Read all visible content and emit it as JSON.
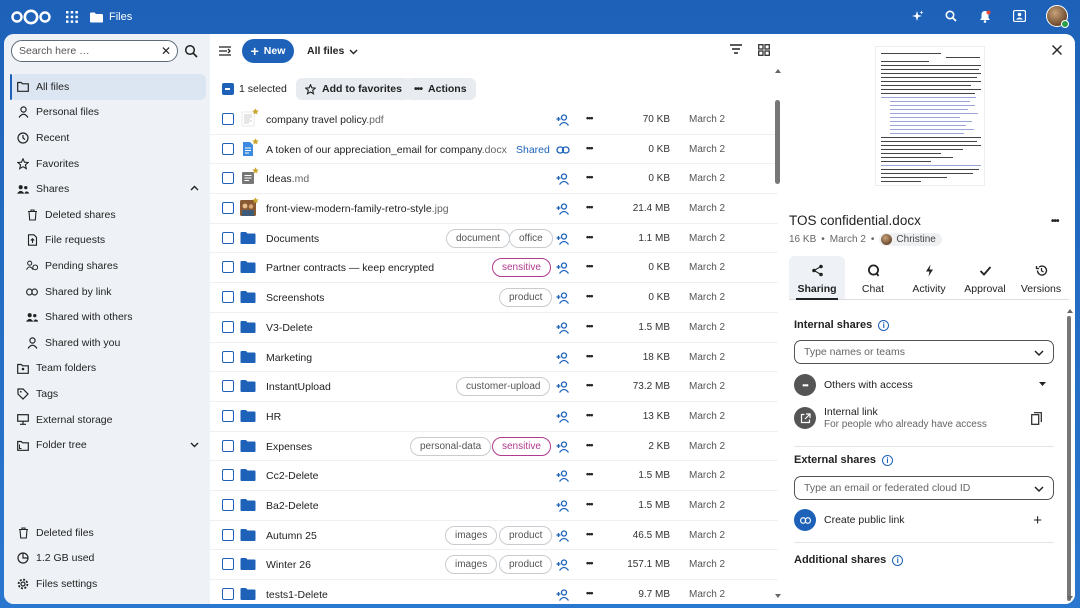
{
  "header": {
    "app_name": "Files"
  },
  "search": {
    "placeholder": "Search here …"
  },
  "nav": {
    "items": [
      {
        "label": "All files",
        "icon": "folder-icon"
      },
      {
        "label": "Personal files",
        "icon": "person-icon"
      },
      {
        "label": "Recent",
        "icon": "clock-icon"
      },
      {
        "label": "Favorites",
        "icon": "star-icon"
      },
      {
        "label": "Shares",
        "icon": "share-icon"
      },
      {
        "label": "Deleted shares",
        "icon": "trash-icon"
      },
      {
        "label": "File requests",
        "icon": "file-upload-icon"
      },
      {
        "label": "Pending shares",
        "icon": "pending-icon"
      },
      {
        "label": "Shared by link",
        "icon": "link-icon"
      },
      {
        "label": "Shared with others",
        "icon": "group-icon"
      },
      {
        "label": "Shared with you",
        "icon": "person-icon"
      },
      {
        "label": "Team folders",
        "icon": "team-folder-icon"
      },
      {
        "label": "Tags",
        "icon": "tag-icon"
      },
      {
        "label": "External storage",
        "icon": "storage-icon"
      },
      {
        "label": "Folder tree",
        "icon": "folder-tree-icon"
      }
    ],
    "bottom": [
      {
        "label": "Deleted files",
        "icon": "trash-icon"
      },
      {
        "label": "1.2 GB used",
        "icon": "pie-icon"
      },
      {
        "label": "Files settings",
        "icon": "gear-icon"
      }
    ]
  },
  "toolbar": {
    "new_label": "New",
    "breadcrumb": "All files"
  },
  "selection": {
    "count": "1 selected",
    "favorite_label": "Add to favorites",
    "actions_label": "Actions"
  },
  "files": [
    {
      "name": "company travel policy",
      "ext": ".pdf",
      "size": "70 KB",
      "date": "March 2",
      "type": "pdf",
      "fav": true,
      "tags": []
    },
    {
      "name": "A token of our appreciation_email for company",
      "ext": ".docx",
      "size": "0 KB",
      "date": "March 2",
      "type": "doc",
      "fav": true,
      "shared": "Shared",
      "tags": []
    },
    {
      "name": "Ideas",
      "ext": ".md",
      "size": "0 KB",
      "date": "March 2",
      "type": "md",
      "fav": true,
      "tags": []
    },
    {
      "name": "front-view-modern-family-retro-style",
      "ext": ".jpg",
      "size": "21.4 MB",
      "date": "March 2",
      "type": "img",
      "fav": true,
      "tags": []
    },
    {
      "name": "Documents",
      "ext": "",
      "size": "1.1 MB",
      "date": "March 2",
      "type": "folder",
      "tags": [
        "document",
        "office"
      ]
    },
    {
      "name": "Partner contracts — keep encrypted",
      "ext": "",
      "size": "0 KB",
      "date": "March 2",
      "type": "folder",
      "tags": [
        "sensitive"
      ]
    },
    {
      "name": "Screenshots",
      "ext": "",
      "size": "0 KB",
      "date": "March 2",
      "type": "folder",
      "tags": [
        "product"
      ]
    },
    {
      "name": "V3-Delete",
      "ext": "",
      "size": "1.5 MB",
      "date": "March 2",
      "type": "folder",
      "tags": []
    },
    {
      "name": "Marketing",
      "ext": "",
      "size": "18 KB",
      "date": "March 2",
      "type": "folder",
      "tags": []
    },
    {
      "name": "InstantUpload",
      "ext": "",
      "size": "73.2 MB",
      "date": "March 2",
      "type": "folder",
      "tags": [
        "customer-upload"
      ]
    },
    {
      "name": "HR",
      "ext": "",
      "size": "13 KB",
      "date": "March 2",
      "type": "folder",
      "tags": []
    },
    {
      "name": "Expenses",
      "ext": "",
      "size": "2 KB",
      "date": "March 2",
      "type": "folder",
      "tags": [
        "personal-data",
        "sensitive"
      ]
    },
    {
      "name": "Cc2-Delete",
      "ext": "",
      "size": "1.5 MB",
      "date": "March 2",
      "type": "folder",
      "tags": []
    },
    {
      "name": "Ba2-Delete",
      "ext": "",
      "size": "1.5 MB",
      "date": "March 2",
      "type": "folder",
      "tags": []
    },
    {
      "name": "Autumn 25",
      "ext": "",
      "size": "46.5 MB",
      "date": "March 2",
      "type": "folder",
      "tags": [
        "images",
        "product"
      ]
    },
    {
      "name": "Winter 26",
      "ext": "",
      "size": "157.1 MB",
      "date": "March 2",
      "type": "folder",
      "tags": [
        "images",
        "product"
      ]
    },
    {
      "name": "tests1-Delete",
      "ext": "",
      "size": "9.7 MB",
      "date": "March 2",
      "type": "folder",
      "tags": []
    }
  ],
  "details": {
    "filename": "TOS confidential.docx",
    "size": "16 KB",
    "date": "March 2",
    "owner": "Christine",
    "tabs": [
      "Sharing",
      "Chat",
      "Activity",
      "Approval",
      "Versions"
    ],
    "internal_title": "Internal shares",
    "internal_placeholder": "Type names or teams",
    "others_access": "Others with access",
    "internal_link": "Internal link",
    "internal_link_sub": "For people who already have access",
    "external_title": "External shares",
    "external_placeholder": "Type an email or federated cloud ID",
    "create_link": "Create public link",
    "additional_title": "Additional shares"
  },
  "colors": {
    "brand": "#1d62b8",
    "sensitive": "#b03a8f"
  }
}
